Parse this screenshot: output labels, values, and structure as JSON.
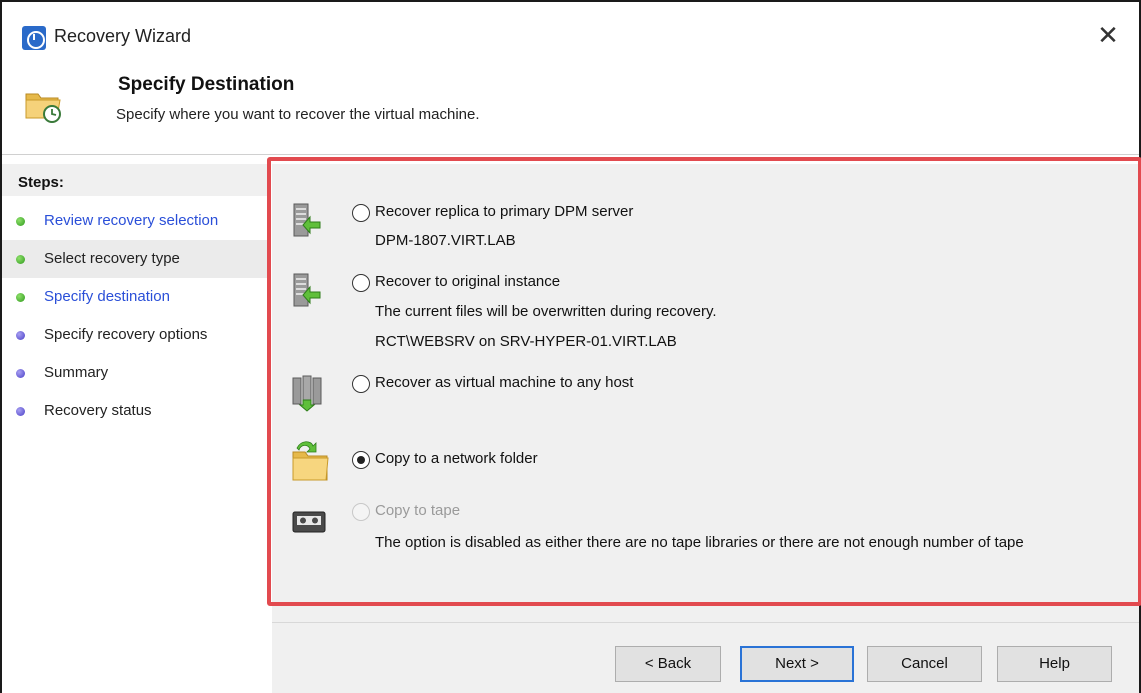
{
  "window": {
    "title": "Recovery Wizard",
    "close_glyph": "✕"
  },
  "header": {
    "title": "Specify Destination",
    "subtitle": "Specify where you want to recover the virtual machine."
  },
  "sidebar": {
    "heading": "Steps:",
    "steps": [
      {
        "label": "Review recovery selection",
        "status": "green",
        "link": true
      },
      {
        "label": "Select recovery type",
        "status": "green",
        "link": false,
        "active": true
      },
      {
        "label": "Specify destination",
        "status": "green",
        "link": true
      },
      {
        "label": "Specify recovery options",
        "status": "purple",
        "link": false
      },
      {
        "label": "Summary",
        "status": "purple",
        "link": false
      },
      {
        "label": "Recovery status",
        "status": "purple",
        "link": false
      }
    ]
  },
  "options": [
    {
      "label": "Recover replica to primary DPM server",
      "details": [
        "DPM-1807.VIRT.LAB"
      ],
      "checked": false,
      "disabled": false,
      "icon": "server-recover-icon"
    },
    {
      "label": "Recover to original instance",
      "details": [
        "The current files will be overwritten during recovery.",
        "RCT\\WEBSRV on SRV-HYPER-01.VIRT.LAB"
      ],
      "checked": false,
      "disabled": false,
      "icon": "server-recover-icon"
    },
    {
      "label": "Recover as virtual machine to any host",
      "details": [],
      "checked": false,
      "disabled": false,
      "icon": "servers-download-icon"
    },
    {
      "label": "Copy to a network folder",
      "details": [],
      "checked": true,
      "disabled": false,
      "icon": "network-folder-icon"
    },
    {
      "label": "Copy to tape",
      "details": [
        "The option is disabled as either there are no tape libraries or there are not enough number of tape"
      ],
      "checked": false,
      "disabled": true,
      "icon": "tape-icon"
    }
  ],
  "footer": {
    "back": "< Back",
    "next": "Next >",
    "cancel": "Cancel",
    "help": "Help"
  },
  "colors": {
    "highlight": "#e24a4f",
    "link": "#2a4fd8",
    "default_button_border": "#2a73d6"
  }
}
